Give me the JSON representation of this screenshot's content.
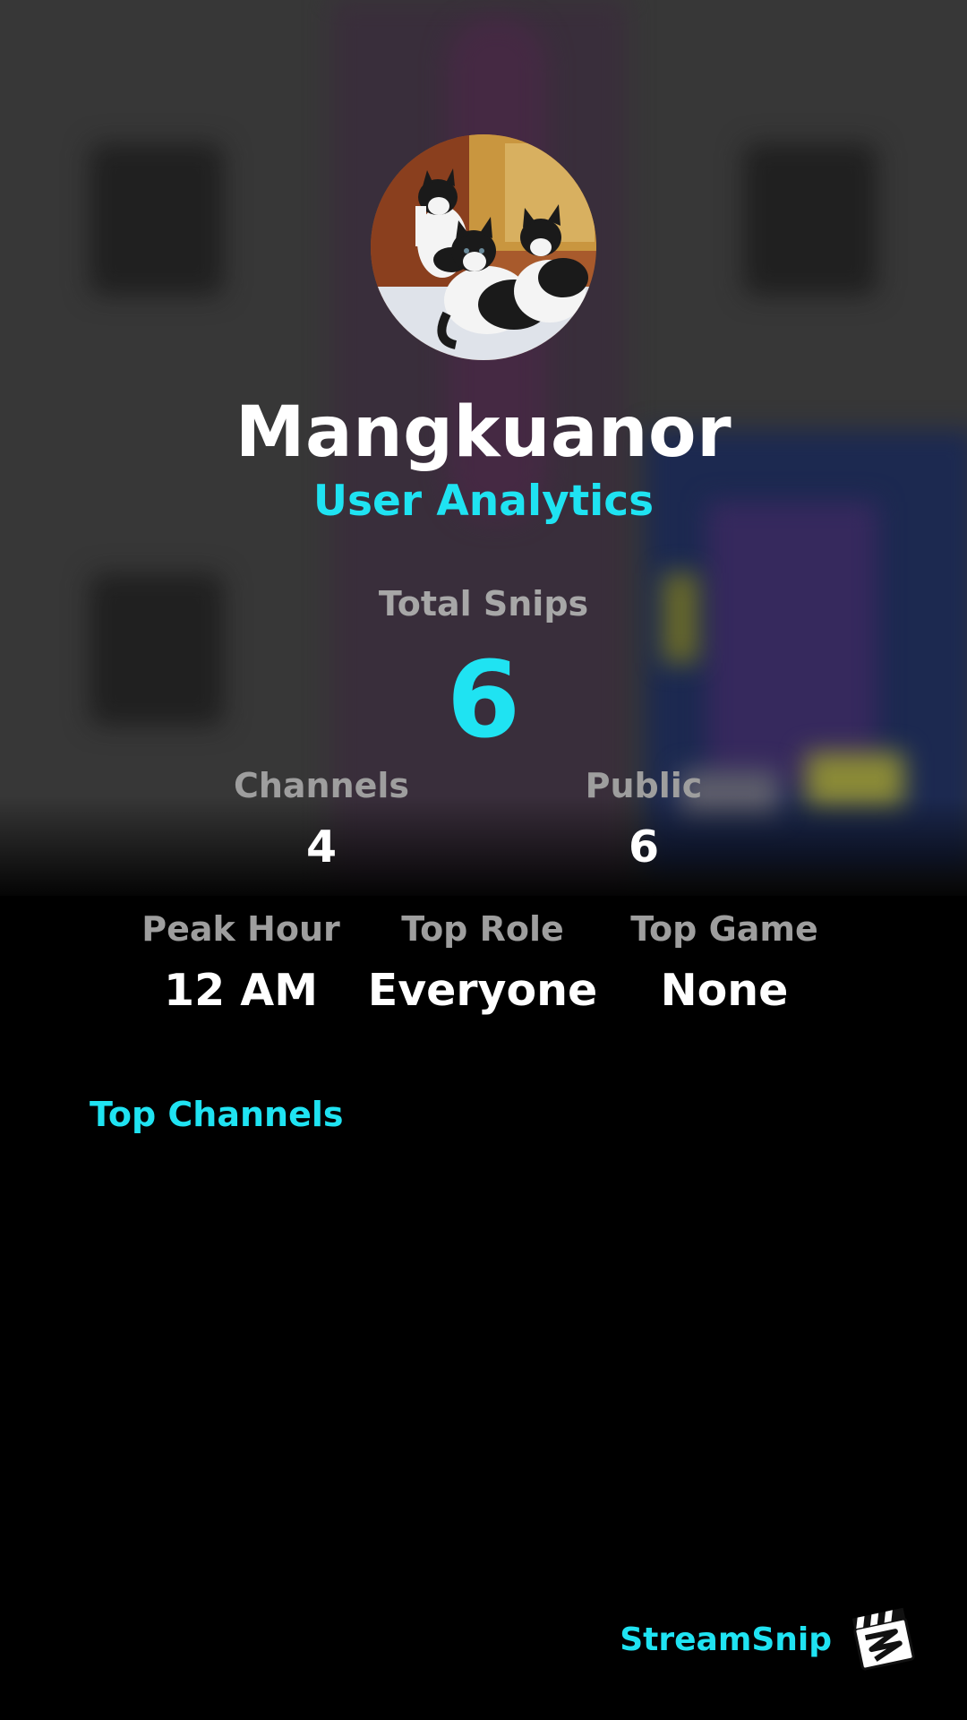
{
  "profile": {
    "username": "Mangkuanor",
    "subtitle": "User Analytics",
    "avatar_icon": "kittens-photo"
  },
  "summary": {
    "total_label": "Total Snips",
    "total_value": "6"
  },
  "stats_row_1": [
    {
      "label": "Channels",
      "value": "4"
    },
    {
      "label": "Public",
      "value": "6"
    }
  ],
  "stats_row_2": [
    {
      "label": "Peak Hour",
      "value": "12 AM"
    },
    {
      "label": "Top Role",
      "value": "Everyone"
    },
    {
      "label": "Top Game",
      "value": "None"
    }
  ],
  "sections": {
    "top_channels": "Top Channels"
  },
  "brand": {
    "name": "StreamSnip",
    "icon": "clapperboard-logo-icon"
  },
  "colors": {
    "accent": "#1fe3f2",
    "label_gray": "#9e9e9e",
    "background": "#000000"
  }
}
